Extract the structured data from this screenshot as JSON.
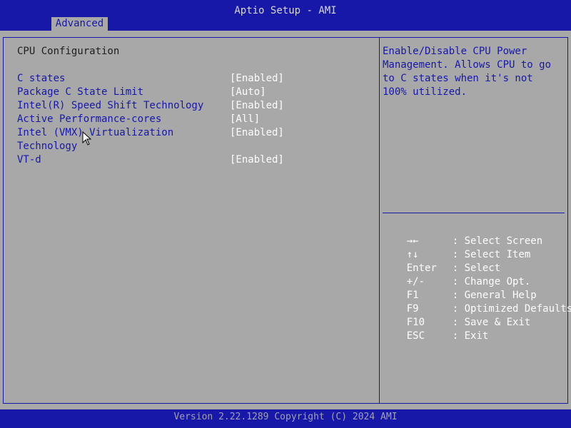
{
  "header": {
    "title": "Aptio Setup - AMI",
    "active_tab": "Advanced"
  },
  "main": {
    "section_title": "CPU Configuration",
    "items": [
      {
        "label": "C states",
        "value": "[Enabled]"
      },
      {
        "label": "Package C State Limit",
        "value": "[Auto]"
      },
      {
        "label": "Intel(R) Speed Shift Technology",
        "value": "[Enabled]"
      },
      {
        "label": "Active Performance-cores",
        "value": "[All]"
      },
      {
        "label": "Intel (VMX) Virtualization",
        "label_line2": "Technology",
        "value": "[Enabled]"
      },
      {
        "label": "VT-d",
        "value": "[Enabled]"
      }
    ]
  },
  "help": {
    "text": "Enable/Disable CPU Power Management. Allows CPU to go to C states when it's not 100% utilized."
  },
  "keys": [
    {
      "key": "→←",
      "desc": ": Select Screen"
    },
    {
      "key": "↑↓",
      "desc": ": Select Item"
    },
    {
      "key": "Enter",
      "desc": ": Select"
    },
    {
      "key": "+/-",
      "desc": ": Change Opt."
    },
    {
      "key": "F1",
      "desc": ": General Help"
    },
    {
      "key": "F9",
      "desc": ": Optimized Defaults"
    },
    {
      "key": "F10",
      "desc": ": Save & Exit"
    },
    {
      "key": "ESC",
      "desc": ": Exit"
    }
  ],
  "footer": {
    "text": "Version 2.22.1289 Copyright (C) 2024 AMI"
  },
  "colors": {
    "background_blue": "#1818a8",
    "panel_gray": "#a8a8a8",
    "selected_white": "#ffffff"
  }
}
